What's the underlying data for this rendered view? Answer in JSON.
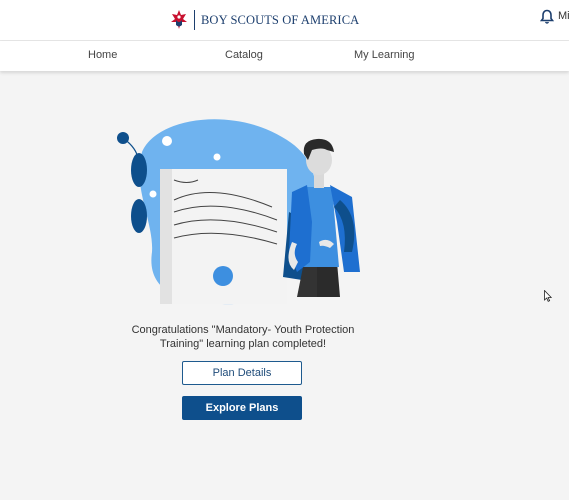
{
  "header": {
    "logo_text": "BOY SCOUTS OF AMERICA",
    "user_initials": "Mi"
  },
  "nav": {
    "home": "Home",
    "catalog": "Catalog",
    "my_learning": "My Learning"
  },
  "main": {
    "message_line1": "Congratulations \"Mandatory- Youth Protection",
    "message_line2": "Training\" learning plan completed!",
    "plan_details_label": "Plan Details",
    "explore_plans_label": "Explore Plans"
  },
  "icons": {
    "logo": "bsa-emblem-icon",
    "bell": "bell-icon",
    "cursor": "mouse-pointer-icon"
  },
  "colors": {
    "brand_blue": "#0e4f8c",
    "accent_blue": "#3d8fe0",
    "light_blue": "#6fb3ef"
  }
}
